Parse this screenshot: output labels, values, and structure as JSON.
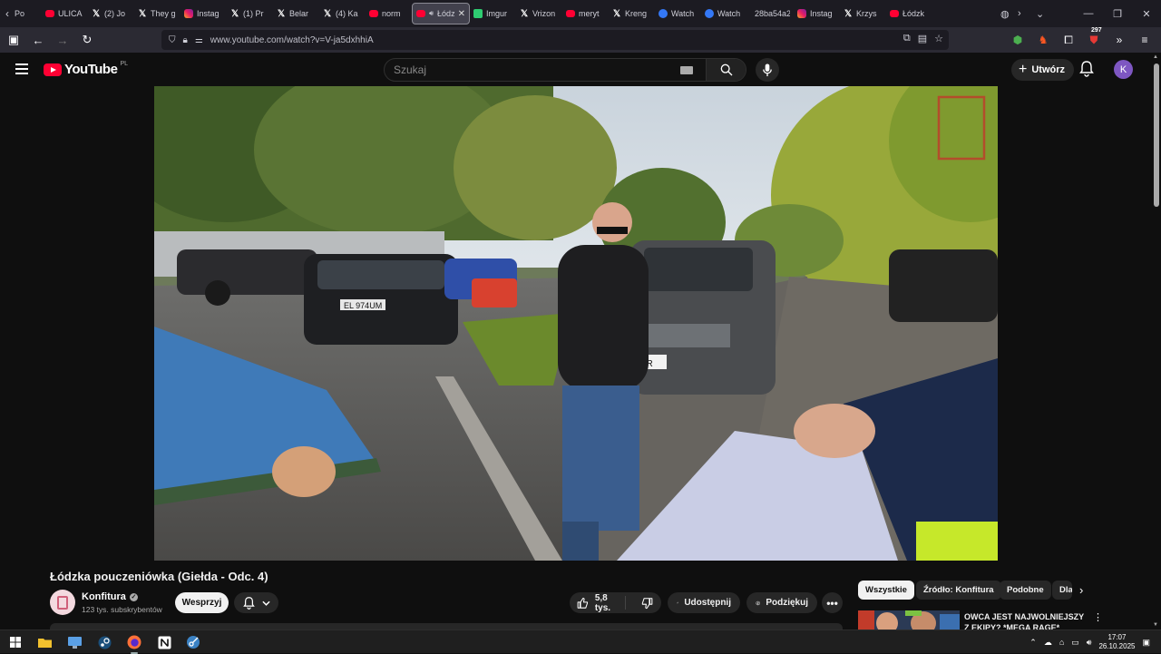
{
  "browser": {
    "tabs": [
      {
        "favicon": "youtube-icon",
        "title": "ULICA"
      },
      {
        "favicon": "x-icon",
        "title": "(2) Jo"
      },
      {
        "favicon": "x-icon",
        "title": "They g"
      },
      {
        "favicon": "instagram-icon",
        "title": "Instag"
      },
      {
        "favicon": "x-icon",
        "title": "(1) Pr"
      },
      {
        "favicon": "x-icon",
        "title": "Belar"
      },
      {
        "favicon": "x-icon",
        "title": "(4) Ka"
      },
      {
        "favicon": "youtube-icon",
        "title": "norm"
      },
      {
        "favicon": "youtube-icon",
        "title": "Łódz",
        "active": true
      },
      {
        "favicon": "imgur-icon",
        "title": "Imgur"
      },
      {
        "favicon": "x-icon",
        "title": "Vrizon"
      },
      {
        "favicon": "youtube-icon",
        "title": "meryt"
      },
      {
        "favicon": "x-icon",
        "title": "Kreng"
      },
      {
        "favicon": "watch-icon",
        "title": "Watch"
      },
      {
        "favicon": "watch-icon",
        "title": "Watch"
      },
      {
        "favicon": "none",
        "title": "28ba54a2"
      },
      {
        "favicon": "instagram-icon",
        "title": "Instag"
      },
      {
        "favicon": "x-icon",
        "title": "Krzys"
      },
      {
        "favicon": "youtube-icon",
        "title": "Łódzk"
      }
    ],
    "first_tab_partial": "Po",
    "url": "www.youtube.com/watch?v=V-ja5dxhhiA",
    "extensions_badge": "297"
  },
  "youtube": {
    "logo_text": "YouTube",
    "country_code": "PL",
    "search_placeholder": "Szukaj",
    "create_label": "Utwórz",
    "avatar_letter": "K"
  },
  "video": {
    "title": "Łódzka pouczeniówka (Giełda - Odc. 4)",
    "channel": "Konfitura",
    "subscribers": "123 tys. subskrybentów",
    "support_label": "Wesprzyj",
    "likes": "5,8 tys.",
    "share_label": "Udostępnij",
    "thanks_label": "Podziękuj",
    "plate_text": "EL 974UM",
    "plate_partial": "7R"
  },
  "chips": [
    {
      "label": "Wszystkie",
      "active": true
    },
    {
      "label": "Źródło: Konfitura",
      "active": false
    },
    {
      "label": "Podobne",
      "active": false
    },
    {
      "label": "Dla",
      "active": false
    }
  ],
  "recommendation": {
    "title": "OWCA JEST NAJWOLNIEJSZY Z EKIPY? *MEGA RAGE*"
  },
  "taskbar": {
    "time": "17:07",
    "date": "26.10.2025"
  }
}
